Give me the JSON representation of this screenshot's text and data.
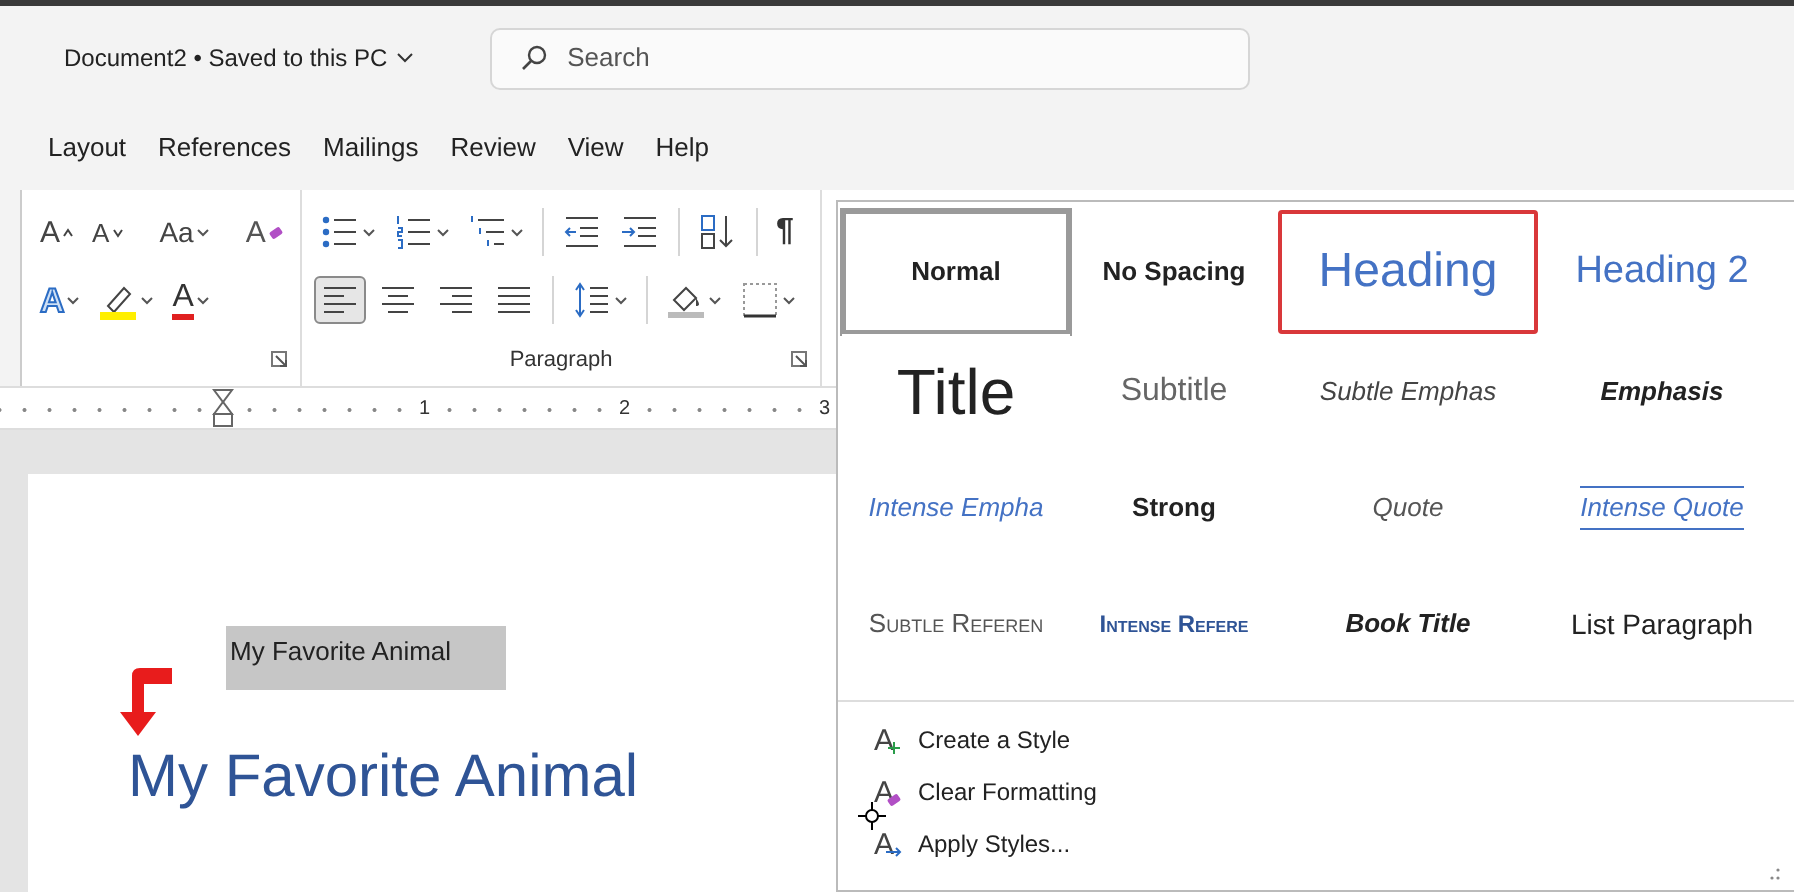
{
  "title_bar": {
    "document": "Document2 • Saved to this PC"
  },
  "search": {
    "placeholder": "Search"
  },
  "tabs": [
    {
      "label": "Layout"
    },
    {
      "label": "References"
    },
    {
      "label": "Mailings"
    },
    {
      "label": "Review"
    },
    {
      "label": "View"
    },
    {
      "label": "Help"
    }
  ],
  "font_group": {
    "row_1": [
      {
        "kind": "grow-font",
        "text": "A",
        "dropdown": false
      },
      {
        "kind": "shrink-font",
        "text": "A",
        "dropdown": false
      },
      {
        "kind": "separator"
      },
      {
        "kind": "change-case",
        "text": "Aa",
        "dropdown": true
      },
      {
        "kind": "separator"
      },
      {
        "kind": "clear-formatting",
        "text": "A",
        "dropdown": false
      }
    ],
    "row_2": [
      {
        "kind": "text-effects",
        "text": "A",
        "dropdown": true
      },
      {
        "kind": "highlight",
        "dropdown": true
      },
      {
        "kind": "font-color",
        "text": "A",
        "dropdown": true
      }
    ]
  },
  "paragraph_group": {
    "label": "Paragraph",
    "row_1": [
      {
        "kind": "bullets",
        "dropdown": true
      },
      {
        "kind": "numbering",
        "dropdown": true
      },
      {
        "kind": "multilevel",
        "dropdown": true
      },
      {
        "kind": "separator"
      },
      {
        "kind": "decrease-indent",
        "dropdown": false
      },
      {
        "kind": "increase-indent",
        "dropdown": false
      },
      {
        "kind": "separator"
      },
      {
        "kind": "sort",
        "dropdown": false
      },
      {
        "kind": "separator"
      },
      {
        "kind": "pilcrow",
        "text": "¶",
        "dropdown": false
      }
    ],
    "alignment": [
      {
        "kind": "align-left",
        "selected": true
      },
      {
        "kind": "align-center",
        "selected": false
      },
      {
        "kind": "align-right",
        "selected": false
      },
      {
        "kind": "justify",
        "selected": false
      }
    ],
    "row_2": [
      {
        "kind": "separator"
      },
      {
        "kind": "line-spacing",
        "dropdown": true
      },
      {
        "kind": "separator"
      },
      {
        "kind": "shading",
        "dropdown": true
      },
      {
        "kind": "borders",
        "dropdown": true
      }
    ]
  },
  "ruler": {
    "labels": [
      "1",
      "2",
      "3"
    ]
  },
  "document": {
    "dragged_text": "My Favorite Animal",
    "heading": "My Favorite Animal"
  },
  "styles_gallery": {
    "styles": [
      {
        "kind": "normal",
        "label": "Normal",
        "selected": true,
        "highlighted": false
      },
      {
        "kind": "no-spacing",
        "label": "No Spacing",
        "selected": false,
        "highlighted": false
      },
      {
        "kind": "heading-1",
        "label": "Heading",
        "selected": false,
        "highlighted": true
      },
      {
        "kind": "heading-2",
        "label": "Heading 2",
        "selected": false,
        "highlighted": false
      },
      {
        "kind": "title",
        "label": "Title",
        "selected": false,
        "highlighted": false
      },
      {
        "kind": "subtitle",
        "label": "Subtitle",
        "selected": false,
        "highlighted": false
      },
      {
        "kind": "subtle-emphasis",
        "label": "Subtle Emphas",
        "selected": false,
        "highlighted": false
      },
      {
        "kind": "emphasis",
        "label": "Emphasis",
        "selected": false,
        "highlighted": false
      },
      {
        "kind": "intense-emphasis",
        "label": "Intense Empha",
        "selected": false,
        "highlighted": false
      },
      {
        "kind": "strong",
        "label": "Strong",
        "selected": false,
        "highlighted": false
      },
      {
        "kind": "quote",
        "label": "Quote",
        "selected": false,
        "highlighted": false
      },
      {
        "kind": "intense-quote",
        "label": "Intense Quote",
        "selected": false,
        "highlighted": false
      },
      {
        "kind": "subtle-reference",
        "label": "Subtle Referen",
        "selected": false,
        "highlighted": false
      },
      {
        "kind": "intense-reference",
        "label": "Intense Refere",
        "selected": false,
        "highlighted": false
      },
      {
        "kind": "book-title",
        "label": "Book Title",
        "selected": false,
        "highlighted": false
      },
      {
        "kind": "list-paragraph",
        "label": "List Paragraph",
        "selected": false,
        "highlighted": false
      }
    ],
    "menu": [
      {
        "kind": "create",
        "glyph": "A",
        "label": "Create a Style"
      },
      {
        "kind": "clear",
        "glyph": "A",
        "label": "Clear Formatting"
      },
      {
        "kind": "apply",
        "glyph": "A",
        "label": "Apply Styles..."
      }
    ]
  }
}
